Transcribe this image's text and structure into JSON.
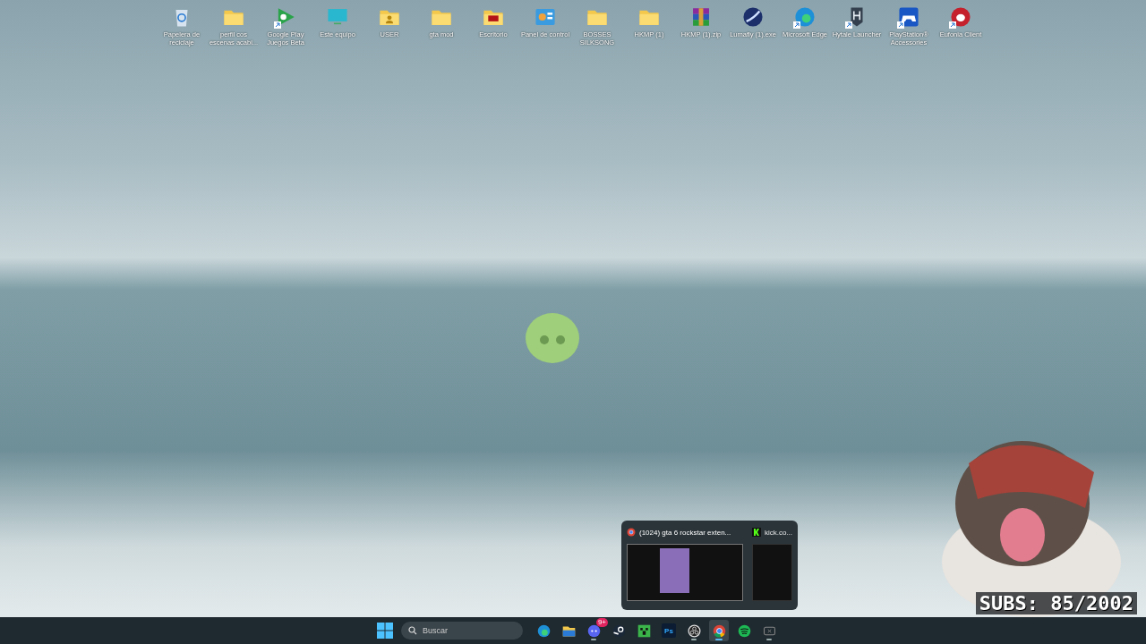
{
  "desktop_icons": [
    {
      "label": "Papelera de reciclaje",
      "kind": "recycle",
      "shortcut": false
    },
    {
      "label": "perfil cos escenas acabi...",
      "kind": "folder",
      "shortcut": false
    },
    {
      "label": "Google Play Juegos Beta",
      "kind": "play",
      "shortcut": true
    },
    {
      "label": "Este equipo",
      "kind": "monitor",
      "shortcut": false
    },
    {
      "label": "USER",
      "kind": "user-folder",
      "shortcut": false
    },
    {
      "label": "gta mod",
      "kind": "folder",
      "shortcut": false
    },
    {
      "label": "Escritorio",
      "kind": "red-folder",
      "shortcut": false
    },
    {
      "label": "Panel de control",
      "kind": "control",
      "shortcut": false
    },
    {
      "label": "BOSSES SILKSONG",
      "kind": "folder",
      "shortcut": false
    },
    {
      "label": "HKMP (1)",
      "kind": "folder",
      "shortcut": false
    },
    {
      "label": "HKMP (1).zip",
      "kind": "archive",
      "shortcut": false
    },
    {
      "label": "Lumafly (1).exe",
      "kind": "orb",
      "shortcut": false
    },
    {
      "label": "Microsoft Edge",
      "kind": "edge",
      "shortcut": true
    },
    {
      "label": "Hytale Launcher",
      "kind": "shield",
      "shortcut": true
    },
    {
      "label": "PlayStation® Accessories",
      "kind": "gamepad",
      "shortcut": true
    },
    {
      "label": "Eufonia Client",
      "kind": "bug",
      "shortcut": true
    }
  ],
  "preview": {
    "windows": [
      {
        "title": "(1024) gta 6 rockstar exten...",
        "kind": "chrome",
        "selected": true
      },
      {
        "title": "kick.co...",
        "kind": "kick",
        "selected": false
      }
    ]
  },
  "taskbar": {
    "search": {
      "placeholder": "Buscar"
    },
    "apps": [
      {
        "kind": "edge",
        "running": false,
        "active": false
      },
      {
        "kind": "files",
        "running": false,
        "active": false
      },
      {
        "kind": "discord",
        "running": true,
        "active": false,
        "badge": "9+"
      },
      {
        "kind": "steam",
        "running": false,
        "active": false
      },
      {
        "kind": "minecraft",
        "running": false,
        "active": false
      },
      {
        "kind": "photoshop",
        "running": false,
        "active": false,
        "text": "Ps"
      },
      {
        "kind": "obs",
        "running": true,
        "active": false
      },
      {
        "kind": "chrome",
        "running": true,
        "active": true
      },
      {
        "kind": "spotify",
        "running": false,
        "active": false
      },
      {
        "kind": "xbox",
        "running": true,
        "active": false
      }
    ]
  },
  "overlay": {
    "subs": "SUBS: 85/2002"
  }
}
